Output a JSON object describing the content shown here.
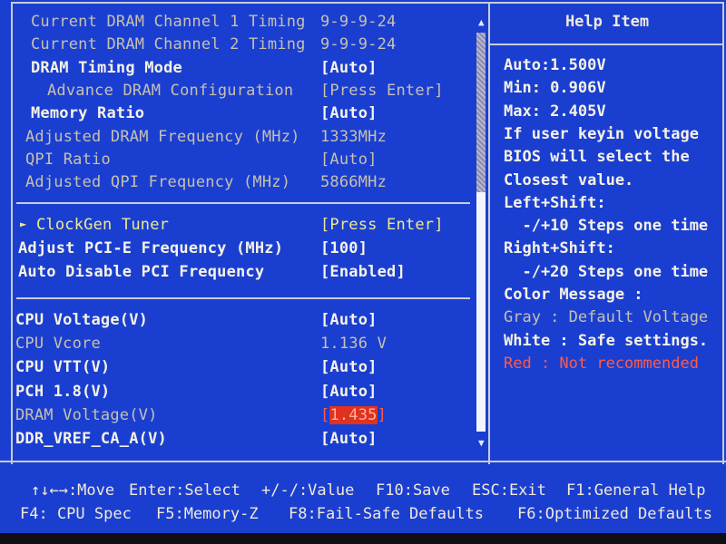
{
  "settings": {
    "rows": [
      {
        "label": "Current DRAM Channel 1 Timing",
        "value": "9-9-9-24",
        "state": "readonly",
        "indent": 2
      },
      {
        "label": "Current DRAM Channel 2 Timing",
        "value": "9-9-9-24",
        "state": "readonly",
        "indent": 2
      },
      {
        "label": "DRAM Timing Mode",
        "value": "[Auto]",
        "state": "safe",
        "indent": 2
      },
      {
        "label": "Advance DRAM Configuration",
        "value": "[Press Enter]",
        "state": "default",
        "indent": 3
      },
      {
        "label": "Memory Ratio",
        "value": "[Auto]",
        "state": "safe",
        "indent": 2
      },
      {
        "label": "Adjusted DRAM Frequency (MHz)",
        "value": "1333MHz",
        "state": "readonly",
        "indent": 1
      },
      {
        "label": "QPI Ratio",
        "value": "[Auto]",
        "state": "default",
        "indent": 1
      },
      {
        "label": "Adjusted QPI Frequency (MHz)",
        "value": "5866MHz",
        "state": "readonly",
        "indent": 1
      }
    ],
    "clock_rows": [
      {
        "label": "ClockGen Tuner",
        "value": "[Press Enter]",
        "state": "submenu"
      },
      {
        "label": "Adjust PCI-E Frequency (MHz)",
        "value": "[100]",
        "state": "safe"
      },
      {
        "label": "Auto Disable PCI Frequency",
        "value": "[Enabled]",
        "state": "safe"
      }
    ],
    "voltage_rows": [
      {
        "label": "CPU Voltage(V)",
        "value": "[Auto]",
        "state": "safe"
      },
      {
        "label": "CPU Vcore",
        "value": "1.136 V",
        "state": "readonly"
      },
      {
        "label": "CPU VTT(V)",
        "value": "[Auto]",
        "state": "safe"
      },
      {
        "label": "PCH 1.8(V)",
        "value": "[Auto]",
        "state": "safe"
      },
      {
        "label": "DRAM Voltage(V)",
        "value": "1.435",
        "state": "selected"
      },
      {
        "label": "DDR_VREF_CA_A(V)",
        "value": "[Auto]",
        "state": "safe"
      }
    ],
    "submenu_marker": "►"
  },
  "scrollbar": {
    "up_icon": "▲",
    "down_icon": "▼",
    "position_fraction": 0.4
  },
  "help": {
    "title": "Help Item",
    "lines": [
      {
        "text": "Auto:1.500V",
        "color": "white"
      },
      {
        "text": "Min: 0.906V",
        "color": "white"
      },
      {
        "text": "Max: 2.405V",
        "color": "white"
      },
      {
        "text": "If user keyin voltage",
        "color": "white"
      },
      {
        "text": "BIOS will select the",
        "color": "white"
      },
      {
        "text": "Closest value.",
        "color": "white"
      },
      {
        "text": "Left+Shift:",
        "color": "white"
      },
      {
        "text": "  -/+10 Steps one time",
        "color": "white"
      },
      {
        "text": "Right+Shift:",
        "color": "white"
      },
      {
        "text": "  -/+20 Steps one time",
        "color": "white"
      },
      {
        "text": "Color Message :",
        "color": "white"
      },
      {
        "text": "Gray : Default Voltage",
        "color": "gray"
      },
      {
        "text": "White : Safe settings.",
        "color": "white"
      },
      {
        "text": "Red : Not recommended",
        "color": "red"
      }
    ]
  },
  "footer": {
    "row1": [
      "↑↓←→:Move",
      "Enter:Select",
      "+/-/:Value",
      "F10:Save",
      "ESC:Exit",
      "F1:General Help"
    ],
    "row2": [
      "F4: CPU Spec",
      "F5:Memory-Z",
      "F8:Fail-Safe Defaults",
      "F6:Optimized Defaults"
    ]
  },
  "colors": {
    "background": "#1a3fd0",
    "white": "#f6f2e6",
    "gray": "#c8c0b0",
    "red": "#ff5a4a",
    "highlight": "#e0321e",
    "submenu": "#f0e890"
  }
}
